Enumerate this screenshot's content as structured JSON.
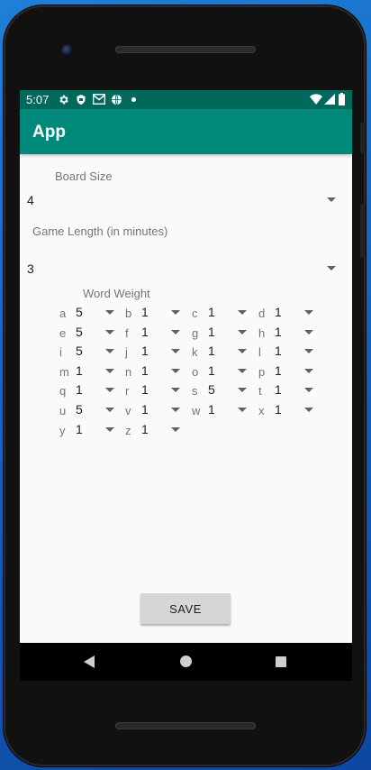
{
  "status_bar": {
    "time": "5:07",
    "icons": [
      "settings-icon",
      "shield-icon",
      "gmail-icon",
      "globe-icon",
      "dot-icon",
      "wifi-icon",
      "signal-icon",
      "battery-icon"
    ]
  },
  "app_bar": {
    "title": "App"
  },
  "board_size": {
    "label": "Board Size",
    "value": "4"
  },
  "game_length": {
    "label": "Game Length (in minutes)",
    "value": "3"
  },
  "word_weight": {
    "label": "Word Weight",
    "items": [
      {
        "letter": "a",
        "value": "5"
      },
      {
        "letter": "b",
        "value": "1"
      },
      {
        "letter": "c",
        "value": "1"
      },
      {
        "letter": "d",
        "value": "1"
      },
      {
        "letter": "e",
        "value": "5"
      },
      {
        "letter": "f",
        "value": "1"
      },
      {
        "letter": "g",
        "value": "1"
      },
      {
        "letter": "h",
        "value": "1"
      },
      {
        "letter": "i",
        "value": "5"
      },
      {
        "letter": "j",
        "value": "1"
      },
      {
        "letter": "k",
        "value": "1"
      },
      {
        "letter": "l",
        "value": "1"
      },
      {
        "letter": "m",
        "value": "1"
      },
      {
        "letter": "n",
        "value": "1"
      },
      {
        "letter": "o",
        "value": "1"
      },
      {
        "letter": "p",
        "value": "1"
      },
      {
        "letter": "q",
        "value": "1"
      },
      {
        "letter": "r",
        "value": "1"
      },
      {
        "letter": "s",
        "value": "5"
      },
      {
        "letter": "t",
        "value": "1"
      },
      {
        "letter": "u",
        "value": "5"
      },
      {
        "letter": "v",
        "value": "1"
      },
      {
        "letter": "w",
        "value": "1"
      },
      {
        "letter": "x",
        "value": "1"
      },
      {
        "letter": "y",
        "value": "1"
      },
      {
        "letter": "z",
        "value": "1"
      }
    ]
  },
  "save_label": "SAVE",
  "nav": {
    "icons": [
      "back-icon",
      "home-icon",
      "recents-icon"
    ]
  },
  "colors": {
    "status_bar": "#00695c",
    "app_bar": "#00897b",
    "background": "#fafafa",
    "desktop": "#1565c0"
  }
}
